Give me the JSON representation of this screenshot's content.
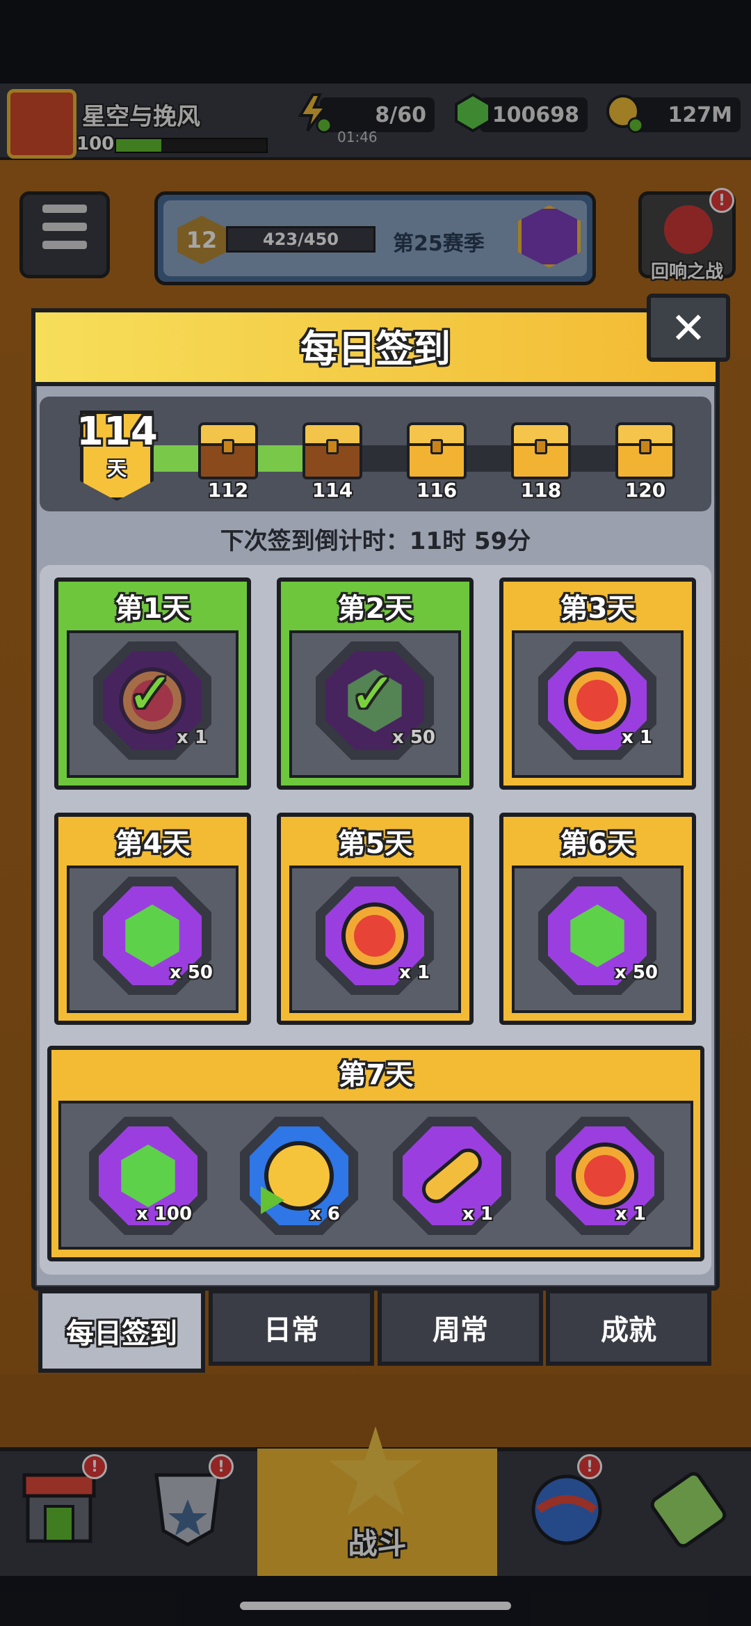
{
  "header": {
    "player_name": "星空与挽风",
    "player_level": "100",
    "energy": "8/60",
    "energy_timer": "01:46",
    "gems": "100698",
    "gold": "127M"
  },
  "season": {
    "level": "12",
    "progress": "423/450",
    "label": "第25赛季"
  },
  "event_button": {
    "label": "回响之战",
    "badge": "!"
  },
  "panel": {
    "title": "每日签到",
    "close_label": "✕",
    "current_day": "114",
    "day_unit": "天",
    "milestones": [
      {
        "day": "112",
        "state": "opened"
      },
      {
        "day": "114",
        "state": "opened"
      },
      {
        "day": "116",
        "state": "locked"
      },
      {
        "day": "118",
        "state": "locked"
      },
      {
        "day": "120",
        "state": "locked"
      }
    ],
    "countdown": "下次签到倒计时：11时 59分"
  },
  "days": [
    {
      "label": "第1天",
      "reward": "heart-coin",
      "qty": "x 1",
      "claimed": true
    },
    {
      "label": "第2天",
      "reward": "gem",
      "qty": "x 50",
      "claimed": true
    },
    {
      "label": "第3天",
      "reward": "heart-coin",
      "qty": "x 1",
      "claimed": false
    },
    {
      "label": "第4天",
      "reward": "gem",
      "qty": "x 50",
      "claimed": false
    },
    {
      "label": "第5天",
      "reward": "heart-coin",
      "qty": "x 1",
      "claimed": false
    },
    {
      "label": "第6天",
      "reward": "gem",
      "qty": "x 50",
      "claimed": false
    }
  ],
  "day7": {
    "label": "第7天",
    "rewards": [
      {
        "reward": "gem",
        "qty": "x 100"
      },
      {
        "reward": "gold-coin",
        "qty": "x 6"
      },
      {
        "reward": "key",
        "qty": "x 1"
      },
      {
        "reward": "heart-coin",
        "qty": "x 1"
      }
    ]
  },
  "tabs": [
    "每日签到",
    "日常",
    "周常",
    "成就"
  ],
  "bottom_nav": {
    "fight_label": "战斗"
  },
  "colors": {
    "claimed": "#6ec63c",
    "pending": "#f3bb33",
    "panel_header": "#f3b932"
  }
}
